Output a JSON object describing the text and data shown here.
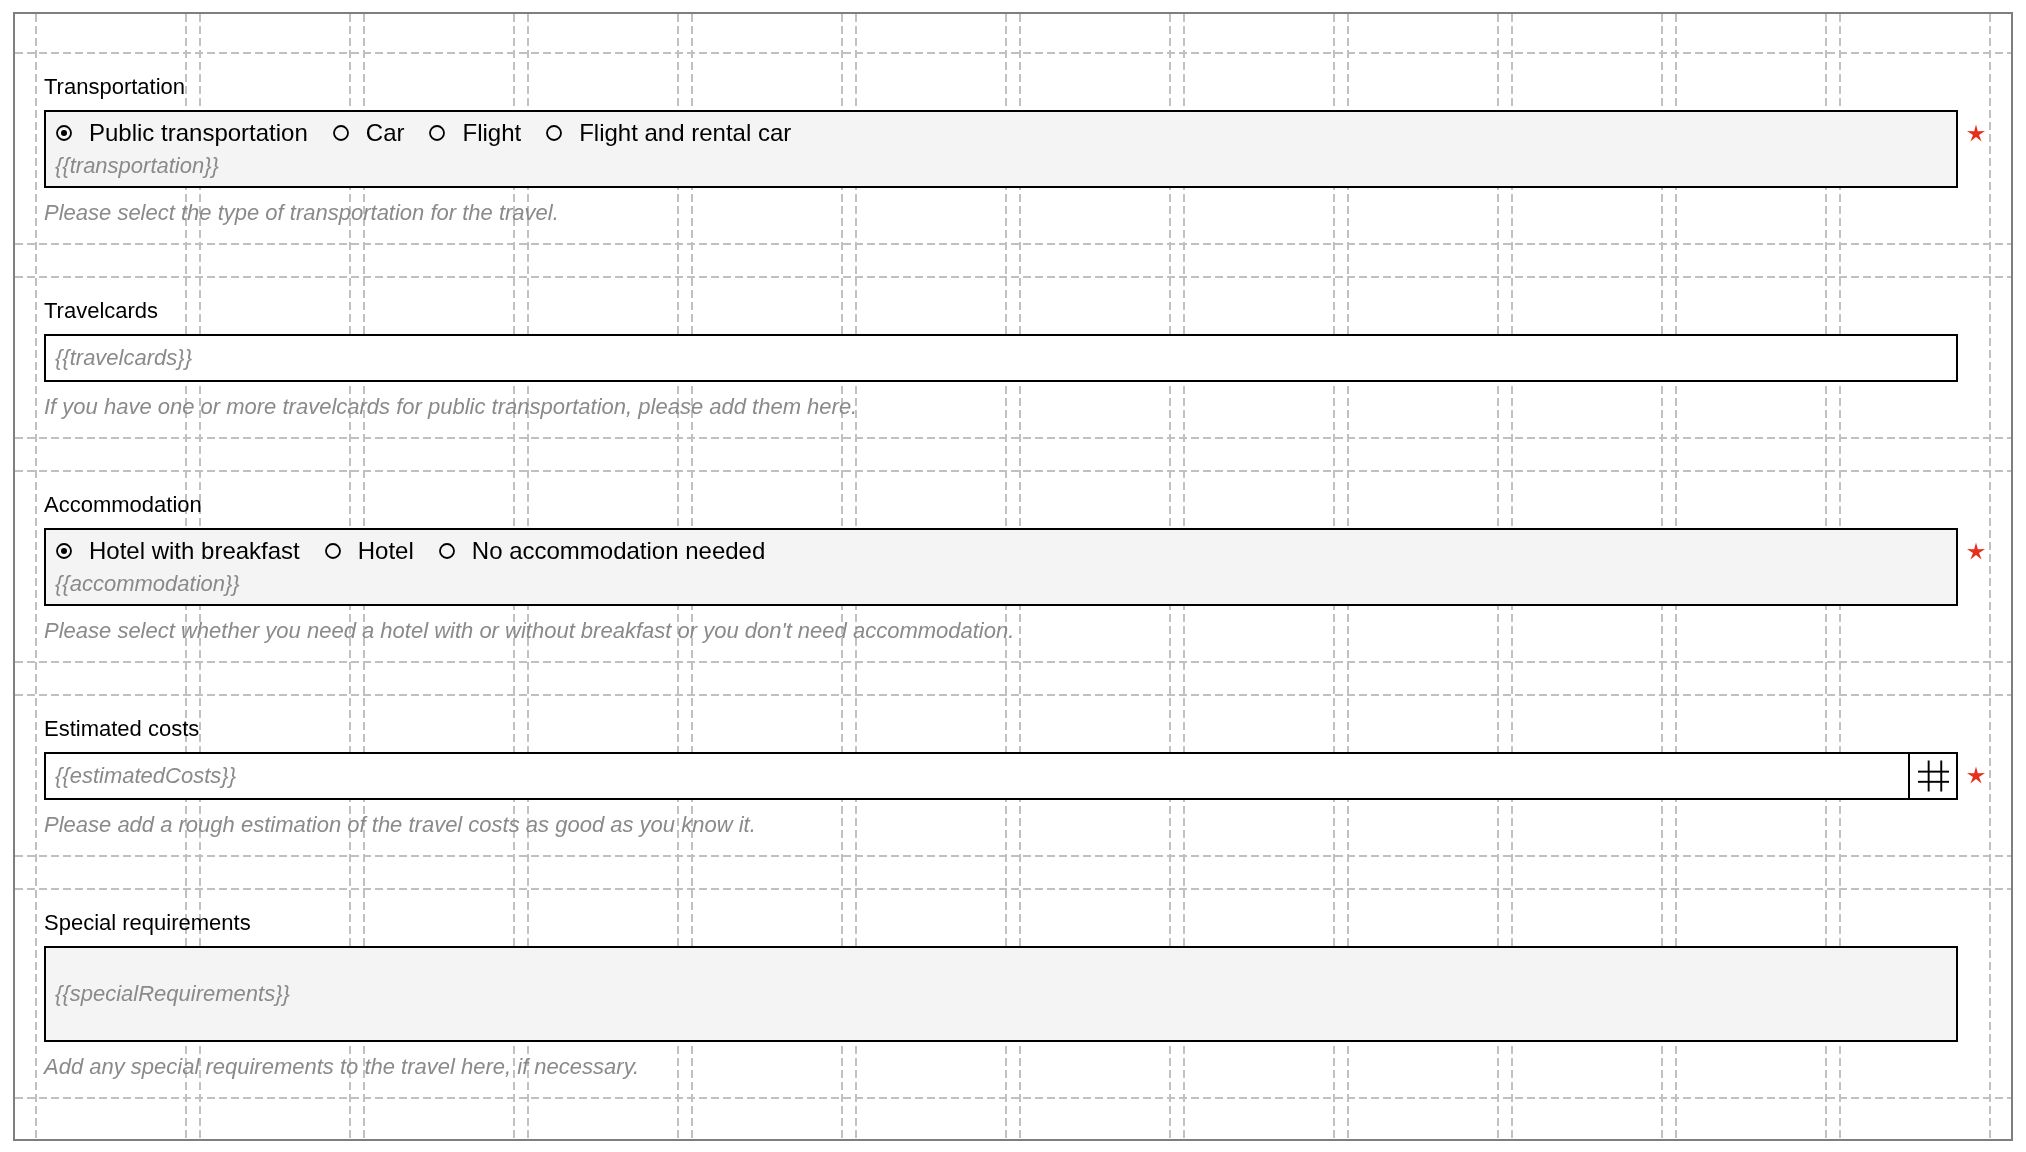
{
  "form": {
    "fields": [
      {
        "kind": "radio",
        "label": "Transportation",
        "required": true,
        "options": [
          {
            "label": "Public transportation",
            "selected": true
          },
          {
            "label": "Car",
            "selected": false
          },
          {
            "label": "Flight",
            "selected": false
          },
          {
            "label": "Flight and rental car",
            "selected": false
          }
        ],
        "placeholder": "{{transportation}}",
        "help": "Please select the type of transportation for the travel."
      },
      {
        "kind": "text",
        "label": "Travelcards",
        "required": false,
        "placeholder": "{{travelcards}}",
        "help": "If you have one or more travelcards for public transportation, please add them here."
      },
      {
        "kind": "radio",
        "label": "Accommodation",
        "required": true,
        "options": [
          {
            "label": "Hotel with breakfast",
            "selected": true
          },
          {
            "label": "Hotel",
            "selected": false
          },
          {
            "label": "No accommodation needed",
            "selected": false
          }
        ],
        "placeholder": "{{accommodation}}",
        "help": "Please select whether you need a hotel with or without breakfast or you don't need accommodation."
      },
      {
        "kind": "number",
        "label": "Estimated costs",
        "required": true,
        "placeholder": "{{estimatedCosts}}",
        "help": "Please add a rough estimation of the travel costs as good as you know it."
      },
      {
        "kind": "textarea",
        "label": "Special requirements",
        "required": false,
        "placeholder": "{{specialRequirements}}",
        "help": "Add any special requirements to the travel here, if necessary."
      }
    ]
  }
}
